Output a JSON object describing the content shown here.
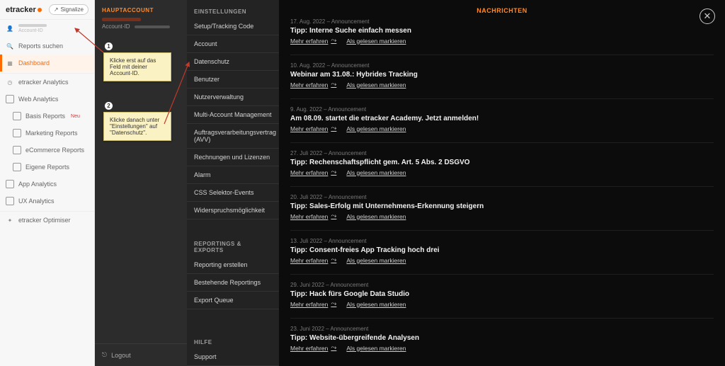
{
  "brand": "etracker",
  "signalize_label": "Signalize",
  "nav": {
    "account_label": "Account-ID",
    "search_label": "Reports suchen",
    "dashboard": "Dashboard",
    "analytics": "etracker Analytics",
    "web": "Web Analytics",
    "basis": "Basis Reports",
    "basis_badge": "Neu",
    "marketing": "Marketing Reports",
    "ecom": "eCommerce Reports",
    "eigene": "Eigene Reports",
    "app": "App Analytics",
    "ux": "UX Analytics",
    "optimiser": "etracker Optimiser"
  },
  "colb": {
    "header": "HAUPTACCOUNT",
    "acct_prefix": "Account-ID",
    "callout1": "Klicke erst auf das Feld mit deiner Account-ID.",
    "callout2": "Klicke danach unter \"Einstellungen\" auf \"Datenschutz\".",
    "logout": "Logout"
  },
  "settings": {
    "header": "EINSTELLUNGEN",
    "items": [
      "Setup/Tracking Code",
      "Account",
      "Datenschutz",
      "Benutzer",
      "Nutzerverwaltung",
      "Multi-Account Management",
      "Auftragsverarbeitungsvertrag (AVV)",
      "Rechnungen und Lizenzen",
      "Alarm",
      "CSS Selektor-Events",
      "Widerspruchsmöglichkeit"
    ],
    "reports_header": "REPORTINGS & EXPORTS",
    "reports": [
      "Reporting erstellen",
      "Bestehende Reportings",
      "Export Queue"
    ],
    "help_header": "HILFE",
    "help": [
      "Support"
    ]
  },
  "feed_header": "NACHRICHTEN",
  "more_label": "Mehr erfahren",
  "read_label": "Als gelesen markieren",
  "messages": [
    {
      "date": "17. Aug. 2022 – Announcement",
      "title": "Tipp: Interne Suche einfach messen"
    },
    {
      "date": "10. Aug. 2022 – Announcement",
      "title": "Webinar am 31.08.: Hybrides Tracking"
    },
    {
      "date": "9. Aug. 2022 – Announcement",
      "title": "Am 08.09. startet die etracker Academy. Jetzt anmelden!"
    },
    {
      "date": "27. Juli 2022 – Announcement",
      "title": "Tipp: Rechenschaftspflicht gem. Art. 5 Abs. 2 DSGVO"
    },
    {
      "date": "20. Juli 2022 – Announcement",
      "title": "Tipp: Sales-Erfolg mit Unternehmens-Erkennung steigern"
    },
    {
      "date": "13. Juli 2022 – Announcement",
      "title": "Tipp: Consent-freies App Tracking hoch drei"
    },
    {
      "date": "29. Juni 2022 – Announcement",
      "title": "Tipp: Hack fürs Google Data Studio"
    },
    {
      "date": "23. Juni 2022 – Announcement",
      "title": "Tipp: Website-übergreifende Analysen"
    }
  ]
}
